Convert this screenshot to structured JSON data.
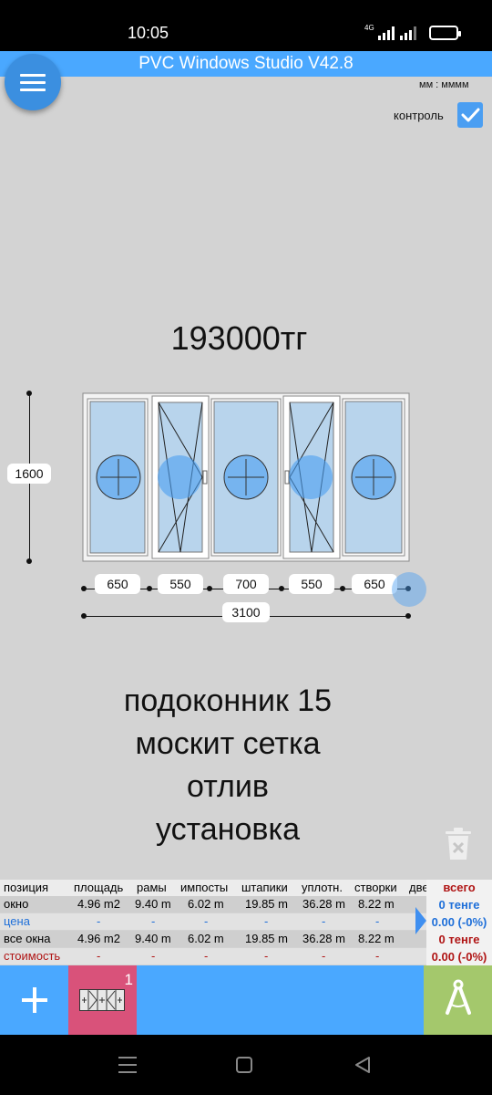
{
  "status_bar": {
    "time": "10:05",
    "network": "4G"
  },
  "app_title": "PVC Windows Studio V42.8",
  "units": "мм : мммм",
  "control": {
    "label": "контроль",
    "checked": true
  },
  "price": "193000тг",
  "window": {
    "height_label": "1600",
    "segment_widths": [
      "650",
      "550",
      "700",
      "550",
      "650"
    ],
    "total_width": "3100"
  },
  "notes": [
    "подоконник 15",
    "москит сетка",
    "отлив",
    "установка"
  ],
  "summary": {
    "headers": [
      "позиция",
      "площадь",
      "рамы",
      "импосты",
      "штапики",
      "уплотн.",
      "створки",
      "две"
    ],
    "rows": [
      {
        "label": "окно",
        "values": [
          "4.96 m2",
          "9.40 m",
          "6.02 m",
          "19.85 m",
          "36.28 m",
          "8.22 m"
        ]
      },
      {
        "label": "цена",
        "values": [
          "-",
          "-",
          "-",
          "-",
          "-",
          "-"
        ]
      },
      {
        "label": "все окна",
        "values": [
          "4.96 m2",
          "9.40 m",
          "6.02 m",
          "19.85 m",
          "36.28 m",
          "8.22 m"
        ]
      },
      {
        "label": "стоимость",
        "values": [
          "-",
          "-",
          "-",
          "-",
          "-",
          "-"
        ]
      }
    ],
    "totals_header": "всего",
    "totals": [
      "0 тенге",
      "0.00 (-0%)",
      "0 тенге",
      "0.00 (-0%)"
    ]
  },
  "bottom_bar": {
    "window_count": "1"
  },
  "colors": {
    "accent": "#4aa8ff",
    "tab_pink": "#d9527a",
    "tool_green": "#a4c86c",
    "total_blue": "#1e6fd9",
    "total_red": "#b01515"
  },
  "icons": [
    "menu-icon",
    "checkmark-icon",
    "trash-icon",
    "plus-icon",
    "window-thumbnail-icon",
    "compass-icon",
    "recent-apps-icon",
    "home-icon",
    "back-icon"
  ]
}
